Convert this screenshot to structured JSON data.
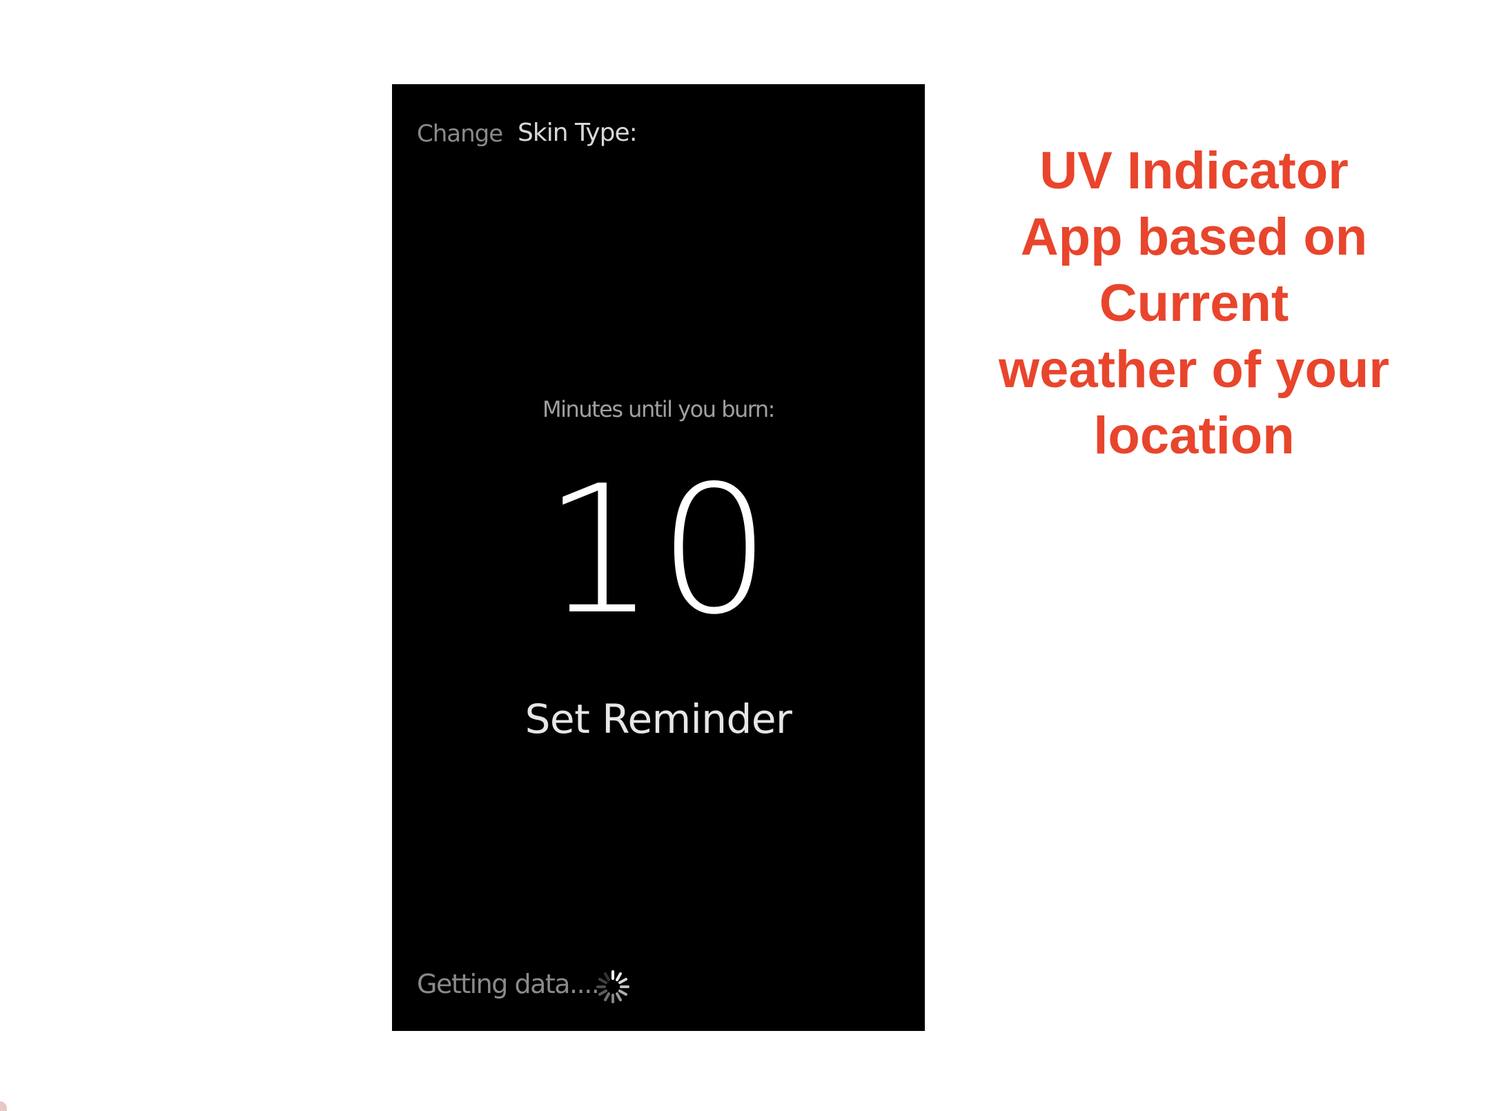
{
  "app": {
    "change_label": "Change",
    "skin_type_label": "Skin Type:",
    "minutes_label": "Minutes until you burn:",
    "minutes_value": "10",
    "set_reminder_label": "Set Reminder",
    "status_text": "Getting data....",
    "spinner_icon": "loading-spinner-icon"
  },
  "caption": {
    "lines": [
      "UV Indicator",
      "App based on",
      "Current",
      "weather of your",
      "location"
    ],
    "color": "#e8452c"
  },
  "colors": {
    "screen_background": "#000000",
    "page_background": "#ffffff"
  }
}
